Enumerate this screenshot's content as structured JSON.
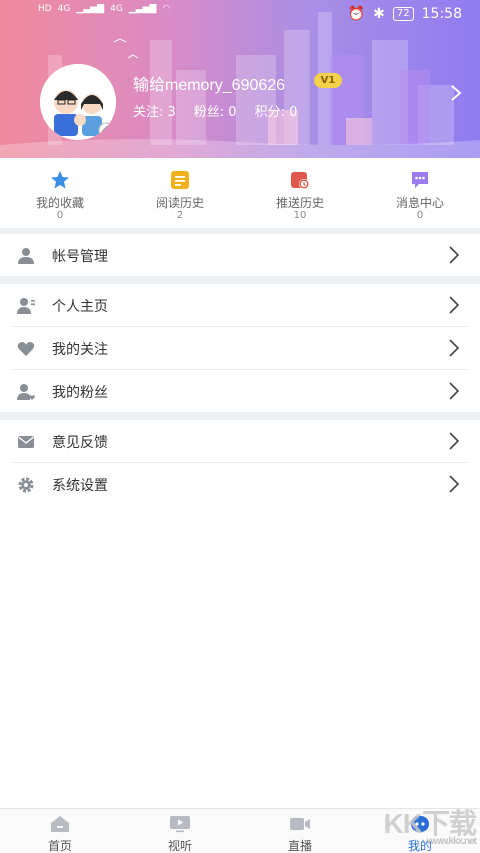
{
  "status_bar": {
    "left_text": [
      "HD",
      "4G",
      "4G"
    ],
    "battery": "72",
    "time": "15:58"
  },
  "profile": {
    "username": "输给memory_690626",
    "vip_label": "V1",
    "stats": {
      "following": "关注: 3",
      "fans": "粉丝: 0",
      "points": "积分: 0"
    }
  },
  "quick_actions": [
    {
      "label": "我的收藏",
      "count": "0",
      "icon": "star-icon",
      "color": "#3a8ee6"
    },
    {
      "label": "阅读历史",
      "count": "2",
      "icon": "reading-icon",
      "color": "#f0b21a"
    },
    {
      "label": "推送历史",
      "count": "10",
      "icon": "push-history-icon",
      "color": "#e0584b"
    },
    {
      "label": "消息中心",
      "count": "0",
      "icon": "message-icon",
      "color": "#9a7cf0"
    }
  ],
  "menu": {
    "account": "帐号管理",
    "homepage": "个人主页",
    "following": "我的关注",
    "fans": "我的粉丝",
    "feedback": "意见反馈",
    "settings": "系统设置"
  },
  "tabbar": [
    {
      "label": "首页",
      "icon": "home-icon"
    },
    {
      "label": "视听",
      "icon": "video-icon"
    },
    {
      "label": "直播",
      "icon": "live-icon"
    },
    {
      "label": "我的",
      "icon": "me-icon"
    }
  ],
  "watermark": {
    "main": "KK下载",
    "sub": "www.kkx.net"
  },
  "colors": {
    "accent": "#2a6fd8",
    "menu_icon": "#8a8f96",
    "separator": "#eef1f4"
  }
}
